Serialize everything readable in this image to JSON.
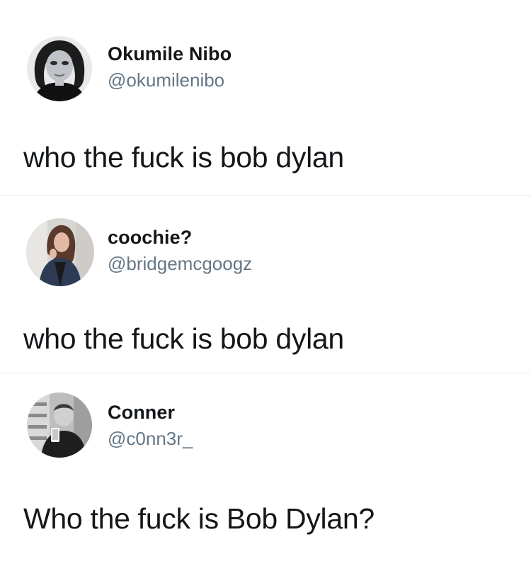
{
  "tweets": [
    {
      "display_name": "Okumile Nibo",
      "handle": "@okumilenibo",
      "text": "who the fuck is bob dylan"
    },
    {
      "display_name": "coochie?",
      "handle": "@bridgemcgoogz",
      "text": "who the fuck is bob dylan"
    },
    {
      "display_name": "Conner",
      "handle": "@c0nn3r_",
      "text": "Who the fuck is Bob Dylan?"
    }
  ],
  "colors": {
    "text_primary": "#14171a",
    "text_secondary": "#657786",
    "divider": "#e3e7ea",
    "background": "#ffffff"
  }
}
